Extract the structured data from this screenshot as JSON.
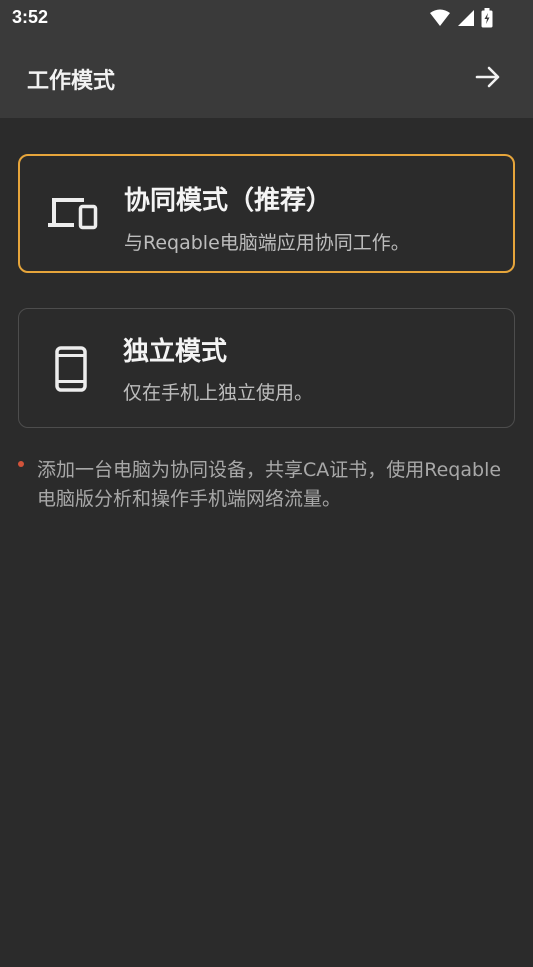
{
  "status_bar": {
    "time": "3:52",
    "icons": [
      "wifi-icon",
      "signal-icon",
      "battery-charging-icon"
    ]
  },
  "app_bar": {
    "title": "工作模式",
    "action_icon": "arrow-right-icon"
  },
  "modes": [
    {
      "icon": "devices-icon",
      "title": "协同模式（推荐）",
      "description": "与Reqable电脑端应用协同工作。",
      "selected": true
    },
    {
      "icon": "smartphone-icon",
      "title": "独立模式",
      "description": "仅在手机上独立使用。",
      "selected": false
    }
  ],
  "note": {
    "text": "添加一台电脑为协同设备，共享CA证书，使用Reqable电脑版分析和操作手机端网络流量。"
  },
  "colors": {
    "background": "#2b2b2b",
    "app_bar": "#3a3a3a",
    "selected_border": "#e6a53b",
    "card_border": "#4d4d4d",
    "bullet": "#d2533a"
  }
}
